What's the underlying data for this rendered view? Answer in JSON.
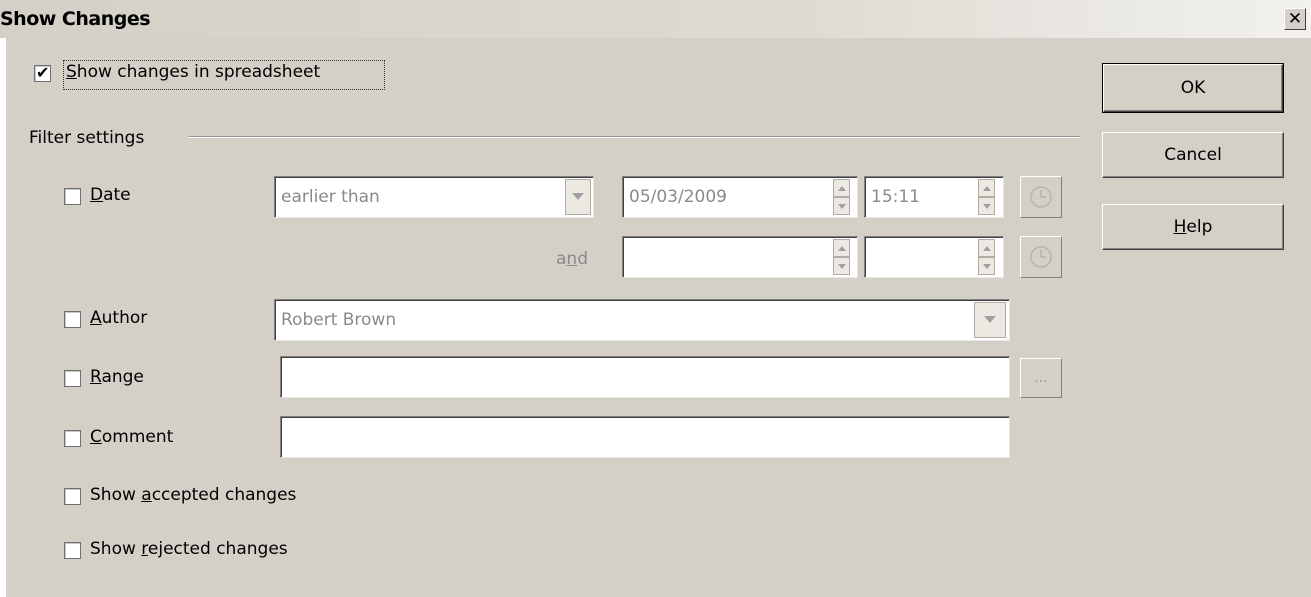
{
  "window": {
    "title": "Show Changes",
    "close_glyph": "✕"
  },
  "show_changes": {
    "prefix": "",
    "mnemonic": "S",
    "rest": "how changes in spreadsheet",
    "checked": true
  },
  "filter": {
    "group_label": "Filter settings",
    "date": {
      "mnemonic": "D",
      "rest": "ate",
      "checked": false,
      "condition": "earlier than",
      "date_value": "05/03/2009",
      "time_value": "15:11",
      "and_prefix": "a",
      "and_mnemonic": "n",
      "and_rest": "d",
      "date2_value": "",
      "time2_value": ""
    },
    "author": {
      "mnemonic": "A",
      "rest": "uthor",
      "checked": false,
      "value": "Robert Brown"
    },
    "range": {
      "mnemonic": "R",
      "rest": "ange",
      "checked": false,
      "value": "",
      "browse_label": "..."
    },
    "comment": {
      "mnemonic": "C",
      "rest": "omment",
      "checked": false,
      "value": ""
    },
    "show_accepted": {
      "prefix": "Show ",
      "mnemonic": "a",
      "rest": "ccepted changes",
      "checked": false
    },
    "show_rejected": {
      "prefix": "Show ",
      "mnemonic": "r",
      "rest": "ejected changes",
      "checked": false
    }
  },
  "buttons": {
    "ok": "OK",
    "cancel": "Cancel",
    "help_mnemonic": "H",
    "help_rest": "elp"
  },
  "icons": {
    "dropdown": "chevron-down-icon",
    "spin_up": "spin-up-icon",
    "spin_down": "spin-down-icon",
    "clock": "clock-icon",
    "close": "close-icon",
    "check": "checkmark-icon"
  }
}
